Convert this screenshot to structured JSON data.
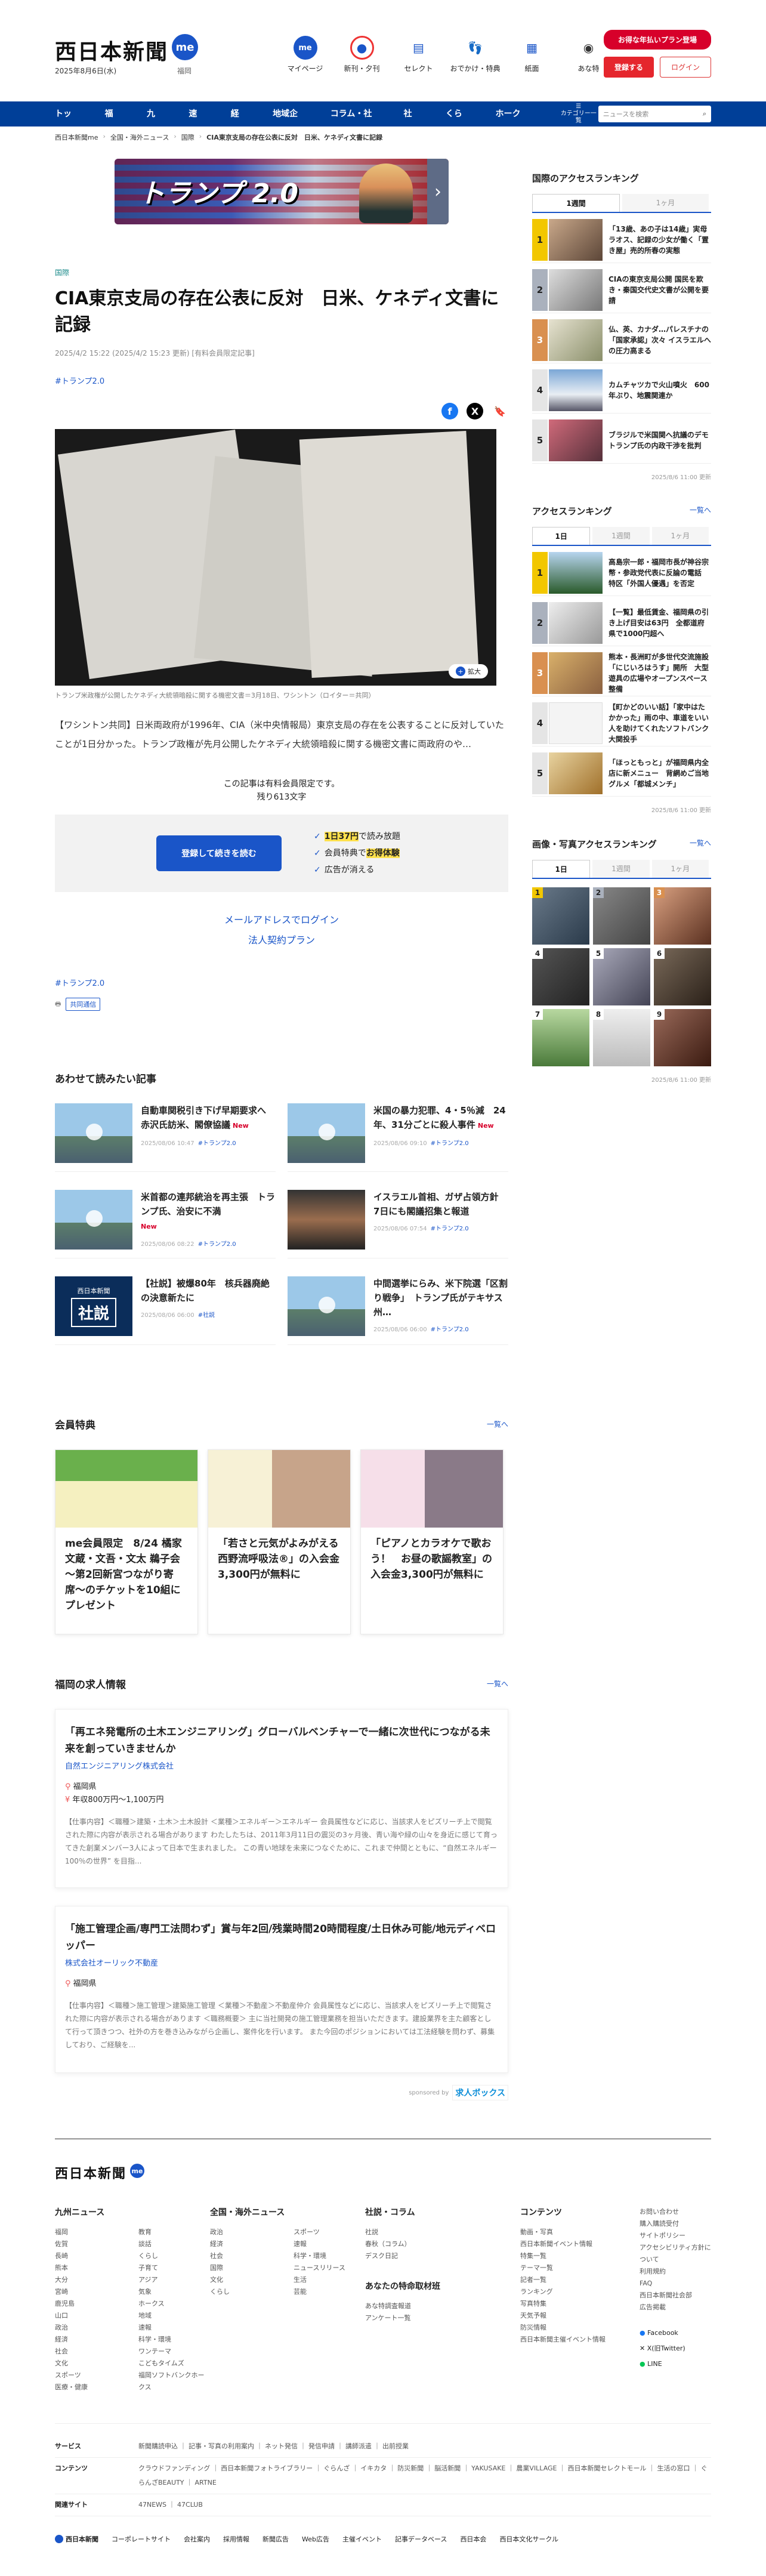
{
  "header": {
    "logo": "西日本新聞",
    "me": "me",
    "date": "2025年8月6日(水)",
    "region": "福岡",
    "icons": [
      {
        "label": "マイページ",
        "icon": "me-icon"
      },
      {
        "label": "新刊・夕刊",
        "icon": "newspaper-icon"
      },
      {
        "label": "セレクト",
        "icon": "select-icon"
      },
      {
        "label": "おでかけ・特典",
        "icon": "footprint-icon"
      },
      {
        "label": "紙面",
        "icon": "paper-icon"
      },
      {
        "label": "あな特",
        "icon": "anatoku-icon"
      }
    ],
    "plan_button": "お得な年払いプラン登場",
    "register": "登録する",
    "login": "ログイン"
  },
  "nav": {
    "items": [
      "トップ",
      "福岡",
      "九州",
      "速報",
      "経済",
      "地域企業",
      "コラム・社説",
      "社会",
      "くらし",
      "ホークス"
    ],
    "category": "カテゴリー一覧",
    "search_placeholder": "ニュースを検索"
  },
  "breadcrumb": [
    "西日本新聞me",
    "全国・海外ニュース",
    "国際",
    "CIA東京支局の存在公表に反対　日米、ケネディ文書に記録"
  ],
  "banner": {
    "text": "トランプ 2.0"
  },
  "article": {
    "category": "国際",
    "title": "CIA東京支局の存在公表に反対　日米、ケネディ文書に記録",
    "meta": "2025/4/2 15:22 (2025/4/2 15:23 更新) [有料会員限定記事]",
    "tag": "#トランプ2.0",
    "caption": "トランプ米政権が公開したケネディ大統領暗殺に関する機密文書＝3月18日、ワシントン（ロイター＝共同）",
    "enlarge": "拡大",
    "lead": "【ワシントン共同】日米両政府が1996年、CIA（米中央情報局）東京支局の存在を公表することに反対していたことが1日分かった。トランプ政権が先月公開したケネディ大統領暗殺に関する機密文書に両政府のや…",
    "members_note": "この記事は有料会員限定です。",
    "remaining": "残り613文字",
    "pay_button": "登録して続きを読む",
    "benefits": [
      {
        "pre": "",
        "hl": "1日37円",
        "post": "で読み放題"
      },
      {
        "pre": "会員特典で",
        "hl": "お得体験",
        "post": ""
      },
      {
        "pre": "広告が消える",
        "hl": "",
        "post": ""
      }
    ],
    "email_login": "メールアドレスでログイン",
    "corporate": "法人契約プラン",
    "tag2": "#トランプ2.0",
    "source": "共同通信"
  },
  "related": {
    "title": "あわせて読みたい記事",
    "items": [
      {
        "title": "自動車関税引き下げ早期要求へ　赤沢氏訪米、閣僚協議",
        "new": "New",
        "date": "2025/08/06 10:47",
        "tag": "#トランプ2.0",
        "thumb": "icon"
      },
      {
        "title": "米国の暴力犯罪、4・5％減　24年、31分ごとに殺人事件",
        "new": "New",
        "date": "2025/08/06 09:10",
        "tag": "#トランプ2.0",
        "thumb": "icon"
      },
      {
        "title": "米首都の連邦統治を再主張　トランプ氏、治安に不満",
        "new": "New",
        "date": "2025/08/06 08:22",
        "tag": "#トランプ2.0",
        "thumb": "icon"
      },
      {
        "title": "イスラエル首相、ガザ占領方針　7日にも閣議招集と報道",
        "new": "",
        "date": "2025/08/06 07:54",
        "tag": "#トランプ2.0",
        "thumb": "photo"
      },
      {
        "title": "【社説】被爆80年　核兵器廃絶の決意新たに",
        "new": "",
        "date": "2025/08/06 06:00",
        "tag": "#社説",
        "thumb": "editorial"
      },
      {
        "title": "中間選挙にらみ、米下院選「区割り戦争」　トランプ氏がテキサス州…",
        "new": "",
        "date": "2025/08/06 06:00",
        "tag": "#トランプ2.0",
        "thumb": "icon"
      }
    ],
    "editorial_label": "西日本新聞",
    "editorial_word": "社説"
  },
  "member_benefits": {
    "title": "会員特典",
    "more": "一覧へ",
    "items": [
      {
        "title": "me会員限定　8/24 橘家文蔵・文吾・文太 鵜子会 〜第2回新宮つながり寄席〜のチケットを10組にプレゼント"
      },
      {
        "title": "「若さと元気がよみがえる西野流呼吸法®」の入会金3,300円が無料に"
      },
      {
        "title": "「ピアノとカラオケで歌おう！　お昼の歌謡教室」の入会金3,300円が無料に"
      }
    ]
  },
  "jobs": {
    "title": "福岡の求人情報",
    "more": "一覧へ",
    "items": [
      {
        "title": "「再エネ発電所の土木エンジニアリング」グローバルベンチャーで一緒に次世代につながる未来を創っていきませんか",
        "company": "自然エンジニアリング株式会社",
        "loc": "福岡県",
        "pay": "年収800万円〜1,100万円",
        "desc": "【仕事内容】＜職種＞建築・土木＞土木設計 ＜業種＞エネルギー＞エネルギー 会員属性などに応じ、当該求人をピズリーチ上で閲覧された際に内容が表示される場合があります わたしたちは、2011年3月11日の震災の3ヶ月後、青い海や緑の山々を身近に感じて育ってきた創業メンバー3人によって日本で生まれました。 この青い地球を未来につなぐために、これまで仲間とともに、“自然エネルギー100％の世界” を目指..."
      },
      {
        "title": "「施工管理企画/専門工法問わず」賞与年2回/残業時間20時間程度/土日休み可能/地元ディベロッパー",
        "company": "株式会社オーリック不動産",
        "loc": "福岡県",
        "pay": "",
        "desc": "【仕事内容】＜職種＞施工管理＞建築施工管理 ＜業種＞不動産＞不動産仲介 会員属性などに応じ、当該求人をピズリーチ上で閲覧された際に内容が表示される場合があります ＜職務概要＞ 主に当社開発の施工管理業務を担当いただきます。建設業界を主た顧客として行って頂きつつ、社外の方を巻き込みながら企画し、案件化を行います。 また今回のポジションにおいては工法経験を問わず、募集しており、ご経験を..."
      }
    ],
    "sponsor": "sponsored by",
    "sponsor_name": "求人ボックス"
  },
  "side": {
    "national_title": "国際のアクセスランキング",
    "national_tabs": [
      "1週間",
      "1ヶ月"
    ],
    "national_items": [
      "「13歳、あの子は14歳」実母ラオス、記録の少女が働く「置き屋」売的所春の実態",
      "CIAの東京支局公開 国民を欺き・秦国交代史文書が公開を要請",
      "仏、英、カナダ…パレスチナの「国家承認」次々 イスラエルへの圧力高まる",
      "カムチャツカで火山噴火　600年ぶり、地震関連か",
      "ブラジルで米国関へ抗議のデモ　トランプ氏の内政干渉を批判"
    ],
    "national_date": "2025/8/6 11:00 更新",
    "access_title": "アクセスランキング",
    "access_more": "一覧へ",
    "access_tabs": [
      "1日",
      "1週間",
      "1ヶ月"
    ],
    "access_items": [
      "高島宗一郎・福岡市長が神谷宗幣・参政党代表に反論の電話 特区「外国人優遇」を否定",
      "【一覧】最低賃金、福岡県の引き上げ目安は63円　全都道府県で1000円超へ",
      "熊本・長洲町が多世代交流施設「にじいろはうす」開所　大型遊具の広場やオープンスペース整備",
      "【町かどのいい話】「家中はたかかった」雨の中、車道をいい人を助けてくれたソフトバンク大関投手",
      "「ほっともっと」が福岡県内全店に新メニュー　背網めご当地グルメ「都城メンチ」"
    ],
    "access_date": "2025/8/6 11:00 更新",
    "photo_title": "画像・写真アクセスランキング",
    "photo_more": "一覧へ",
    "photo_tabs": [
      "1日",
      "1週間",
      "1ヶ月"
    ],
    "photo_nums": [
      "1",
      "2",
      "3",
      "4",
      "5",
      "6",
      "7",
      "8",
      "9"
    ],
    "photo_date": "2025/8/6 11:00 更新"
  },
  "footer": {
    "logo": "西日本新聞",
    "cols": [
      {
        "title": "九州ニュース",
        "items": [
          "福岡",
          "佐賀",
          "長崎",
          "熊本",
          "大分",
          "宮崎",
          "鹿児島",
          "山口",
          "政治",
          "経済",
          "社会",
          "文化",
          "スポーツ",
          "医療・健康",
          "教育",
          "談話",
          "くらし",
          "子育て",
          "アジア",
          "気象",
          "ホークス",
          "地域",
          "速報",
          "科学・環境",
          "ワンテーマ",
          "こどもタイムズ",
          "福岡ソフトバンクホークス"
        ]
      },
      {
        "title": "全国・海外ニュース",
        "items": [
          "政治",
          "経済",
          "社会",
          "国際",
          "文化",
          "くらし",
          "スポーツ",
          "速報",
          "科学・環境",
          "ニュースリリース",
          "生活",
          "芸能"
        ]
      },
      {
        "title": "社説・コラム",
        "items": [
          "社説",
          "春秋（コラム）",
          "デスク日記"
        ]
      },
      {
        "title": "コンテンツ",
        "items": [
          "動画・写真",
          "西日本新聞イベント情報",
          "特集一覧",
          "テーマ一覧",
          "記者一覧",
          "ランキング",
          "写真特集",
          "天気予報",
          "防災情報",
          "西日本新聞主催イベント情報"
        ]
      }
    ],
    "col_extra_title": "あなたの特命取材班",
    "col_extra_items": [
      "あな特調査報道",
      "アンケート一覧"
    ],
    "right_items": [
      "お問い合わせ",
      "購入購読受付",
      "サイトポリシー",
      "アクセシビリティ方針について",
      "利用規約",
      "FAQ",
      "西日本新聞社会部",
      "広告掲載"
    ],
    "social": [
      "Facebook",
      "X(旧Twitter)",
      "LINE"
    ],
    "rows": [
      {
        "label": "サービス",
        "items": "新聞購読申込 ｜ 記事・写真の利用案内 ｜ ネット発信 ｜ 発信申請 ｜ 講師派遣 ｜ 出前授業"
      },
      {
        "label": "コンテンツ",
        "items": "クラウドファンディング ｜ 西日本新聞フォトライブラリー ｜ ぐらんざ ｜ イキカタ ｜ 防災新聞 ｜ 脳活新聞 ｜ YAKUSAKE ｜ 農業VILLAGE ｜ 西日本新聞セレクトモール ｜ 生活の窓口 ｜ ぐらんざBEAUTY ｜ ARTNE"
      },
      {
        "label": "関連サイト",
        "items": "47NEWS ｜ 47CLUB"
      }
    ],
    "bottom": [
      "西日本新聞",
      "コーポレートサイト",
      "会社案内",
      "採用情報",
      "新聞広告",
      "Web広告",
      "主催イベント",
      "記事データベース",
      "西日本会",
      "西日本文化サークル"
    ]
  }
}
